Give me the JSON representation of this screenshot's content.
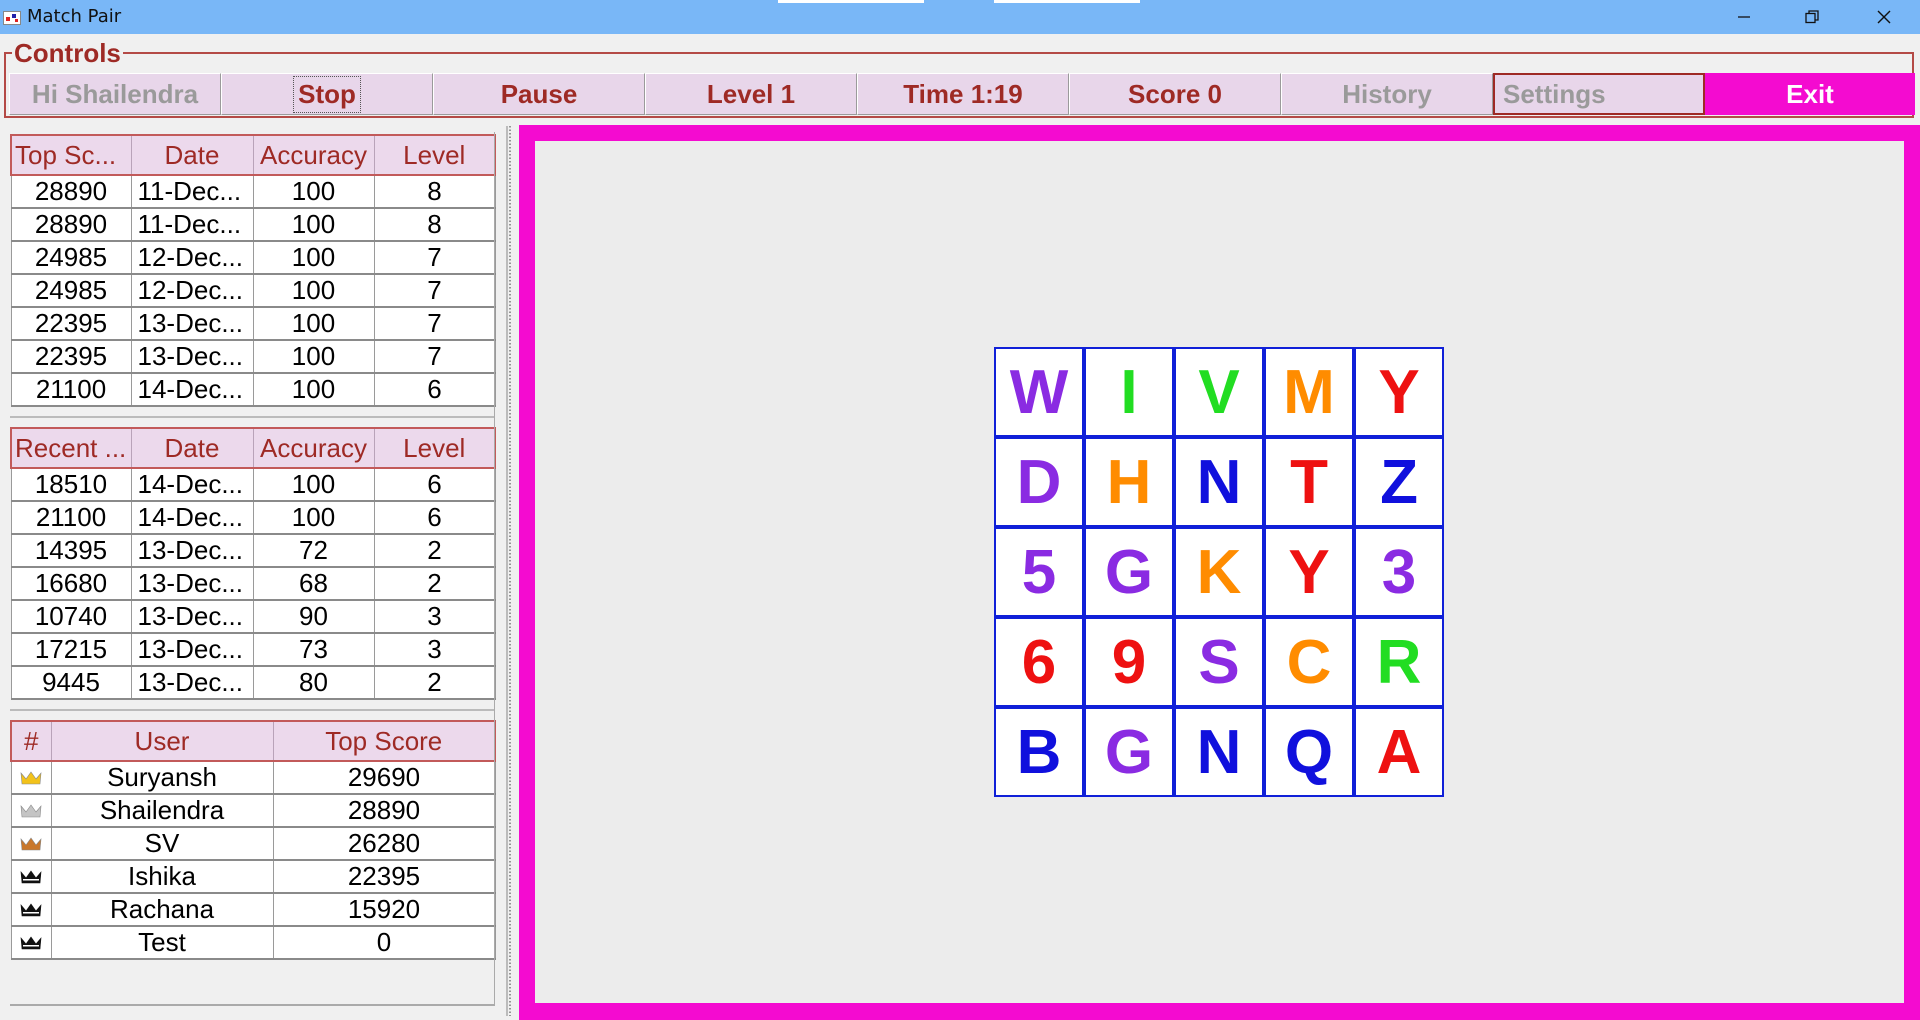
{
  "window": {
    "title": "Match Pair"
  },
  "controls": {
    "legend": "Controls",
    "buttons": [
      {
        "id": "greeting",
        "label": "Hi Shailendra",
        "state": "disabled"
      },
      {
        "id": "stop",
        "label": "Stop",
        "state": "focused"
      },
      {
        "id": "pause",
        "label": "Pause",
        "state": "normal"
      },
      {
        "id": "level",
        "label": "Level 1",
        "state": "normal"
      },
      {
        "id": "time",
        "label": "Time 1:19",
        "state": "normal"
      },
      {
        "id": "score",
        "label": "Score 0",
        "state": "normal"
      },
      {
        "id": "history",
        "label": "History",
        "state": "disabled"
      },
      {
        "id": "settings",
        "label": "Settings",
        "state": "disabled"
      },
      {
        "id": "exit",
        "label": "Exit",
        "state": "primary"
      }
    ]
  },
  "top_scores": {
    "headers": [
      "Top Sc...",
      "Date",
      "Accuracy",
      "Level"
    ],
    "rows": [
      [
        "28890",
        "11-Dec...",
        "100",
        "8"
      ],
      [
        "28890",
        "11-Dec...",
        "100",
        "8"
      ],
      [
        "24985",
        "12-Dec...",
        "100",
        "7"
      ],
      [
        "24985",
        "12-Dec...",
        "100",
        "7"
      ],
      [
        "22395",
        "13-Dec...",
        "100",
        "7"
      ],
      [
        "22395",
        "13-Dec...",
        "100",
        "7"
      ],
      [
        "21100",
        "14-Dec...",
        "100",
        "6"
      ]
    ]
  },
  "recent_scores": {
    "headers": [
      "Recent ...",
      "Date",
      "Accuracy",
      "Level"
    ],
    "rows": [
      [
        "18510",
        "14-Dec...",
        "100",
        "6"
      ],
      [
        "21100",
        "14-Dec...",
        "100",
        "6"
      ],
      [
        "14395",
        "13-Dec...",
        "72",
        "2"
      ],
      [
        "16680",
        "13-Dec...",
        "68",
        "2"
      ],
      [
        "10740",
        "13-Dec...",
        "90",
        "3"
      ],
      [
        "17215",
        "13-Dec...",
        "73",
        "3"
      ],
      [
        "9445",
        "13-Dec...",
        "80",
        "2"
      ]
    ]
  },
  "leaderboard": {
    "headers": [
      "#",
      "User",
      "Top Score"
    ],
    "rows": [
      {
        "crown": "gold-crown-icon",
        "crown_color": "#f2c21b",
        "user": "Suryansh",
        "score": "29690"
      },
      {
        "crown": "silver-crown-icon",
        "crown_color": "#c4c4c4",
        "user": "Shailendra",
        "score": "28890"
      },
      {
        "crown": "bronze-crown-icon",
        "crown_color": "#c9772b",
        "user": "SV",
        "score": "26280"
      },
      {
        "crown": "black-crown-icon",
        "crown_color": "#111111",
        "user": "Ishika",
        "score": "22395"
      },
      {
        "crown": "black-crown-icon",
        "crown_color": "#111111",
        "user": "Rachana",
        "score": "15920"
      },
      {
        "crown": "black-crown-icon",
        "crown_color": "#111111",
        "user": "Test",
        "score": "0"
      }
    ]
  },
  "board": {
    "tiles": [
      {
        "ch": "W",
        "color": "#8a2be2"
      },
      {
        "ch": "I",
        "color": "#22dd22"
      },
      {
        "ch": "V",
        "color": "#22dd22"
      },
      {
        "ch": "M",
        "color": "#ff8c00"
      },
      {
        "ch": "Y",
        "color": "#ee1111"
      },
      {
        "ch": "D",
        "color": "#8a2be2"
      },
      {
        "ch": "H",
        "color": "#ff8c00"
      },
      {
        "ch": "N",
        "color": "#1010dd"
      },
      {
        "ch": "T",
        "color": "#ee1111"
      },
      {
        "ch": "Z",
        "color": "#1010dd"
      },
      {
        "ch": "5",
        "color": "#8a2be2"
      },
      {
        "ch": "G",
        "color": "#8a2be2"
      },
      {
        "ch": "K",
        "color": "#ff8c00"
      },
      {
        "ch": "Y",
        "color": "#ee1111"
      },
      {
        "ch": "3",
        "color": "#8a2be2"
      },
      {
        "ch": "6",
        "color": "#ee1111"
      },
      {
        "ch": "9",
        "color": "#ee1111"
      },
      {
        "ch": "S",
        "color": "#8a2be2"
      },
      {
        "ch": "C",
        "color": "#ff8c00"
      },
      {
        "ch": "R",
        "color": "#22dd22"
      },
      {
        "ch": "B",
        "color": "#1010dd"
      },
      {
        "ch": "G",
        "color": "#8a2be2"
      },
      {
        "ch": "N",
        "color": "#1010dd"
      },
      {
        "ch": "Q",
        "color": "#1010dd"
      },
      {
        "ch": "A",
        "color": "#ee1111"
      }
    ]
  },
  "colors": {
    "accent": "#9e2a25",
    "frame": "#f40bd0",
    "titlebar": "#79b7f7",
    "tile_border": "#1020d8"
  }
}
